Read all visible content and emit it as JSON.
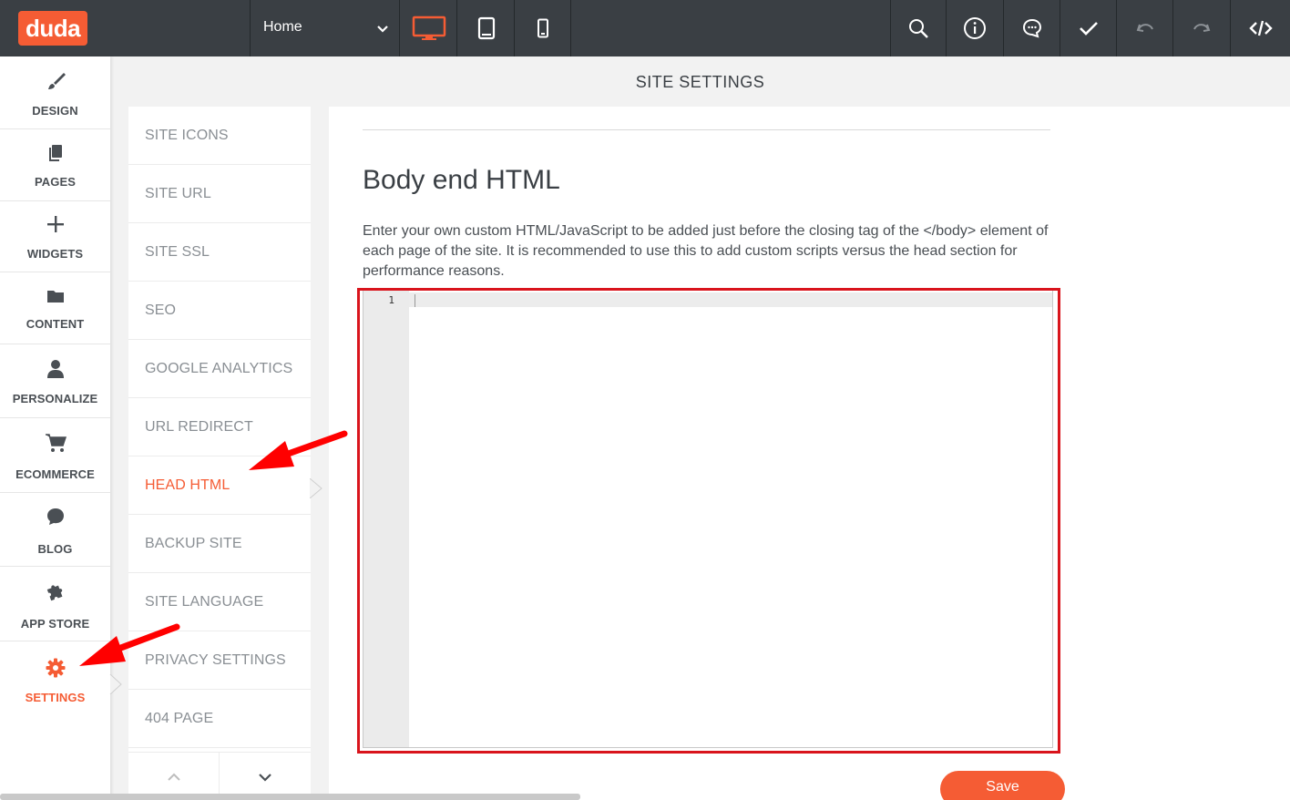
{
  "app": {
    "logo": "duda"
  },
  "toolbar": {
    "page_select": "Home",
    "buttons": [
      "desktop-view",
      "tablet-view",
      "mobile-view",
      "search",
      "info",
      "comments",
      "publish",
      "undo",
      "redo",
      "dev-mode"
    ],
    "active_view": "desktop-view"
  },
  "sidebar": {
    "items": [
      {
        "label": "DESIGN",
        "icon": "brush-icon"
      },
      {
        "label": "PAGES",
        "icon": "pages-icon"
      },
      {
        "label": "WIDGETS",
        "icon": "plus-icon"
      },
      {
        "label": "CONTENT",
        "icon": "folder-icon"
      },
      {
        "label": "PERSONALIZE",
        "icon": "person-icon"
      },
      {
        "label": "ECOMMERCE",
        "icon": "cart-icon"
      },
      {
        "label": "BLOG",
        "icon": "chat-bubble-icon"
      },
      {
        "label": "APP STORE",
        "icon": "puzzle-icon"
      },
      {
        "label": "SETTINGS",
        "icon": "gear-icon"
      }
    ],
    "active": "SETTINGS"
  },
  "header": {
    "title": "SITE SETTINGS"
  },
  "submenu": {
    "items": [
      "SITE ICONS",
      "SITE URL",
      "SITE SSL",
      "SEO",
      "GOOGLE ANALYTICS",
      "URL REDIRECT",
      "HEAD HTML",
      "BACKUP SITE",
      "SITE LANGUAGE",
      "PRIVACY SETTINGS",
      "404 PAGE"
    ],
    "active": "HEAD HTML"
  },
  "main": {
    "section_title": "Body end HTML",
    "description": "Enter your own custom HTML/JavaScript to be added just before the closing tag of the </body> element of each page of the site. It is recommended to use this to add custom scripts versus the head section for performance reasons.",
    "editor": {
      "line_numbers": [
        "1"
      ],
      "content": ""
    },
    "save_label": "Save"
  },
  "colors": {
    "accent": "#f55c34",
    "topbar": "#3a3f44",
    "annotation": "#d9141c"
  }
}
